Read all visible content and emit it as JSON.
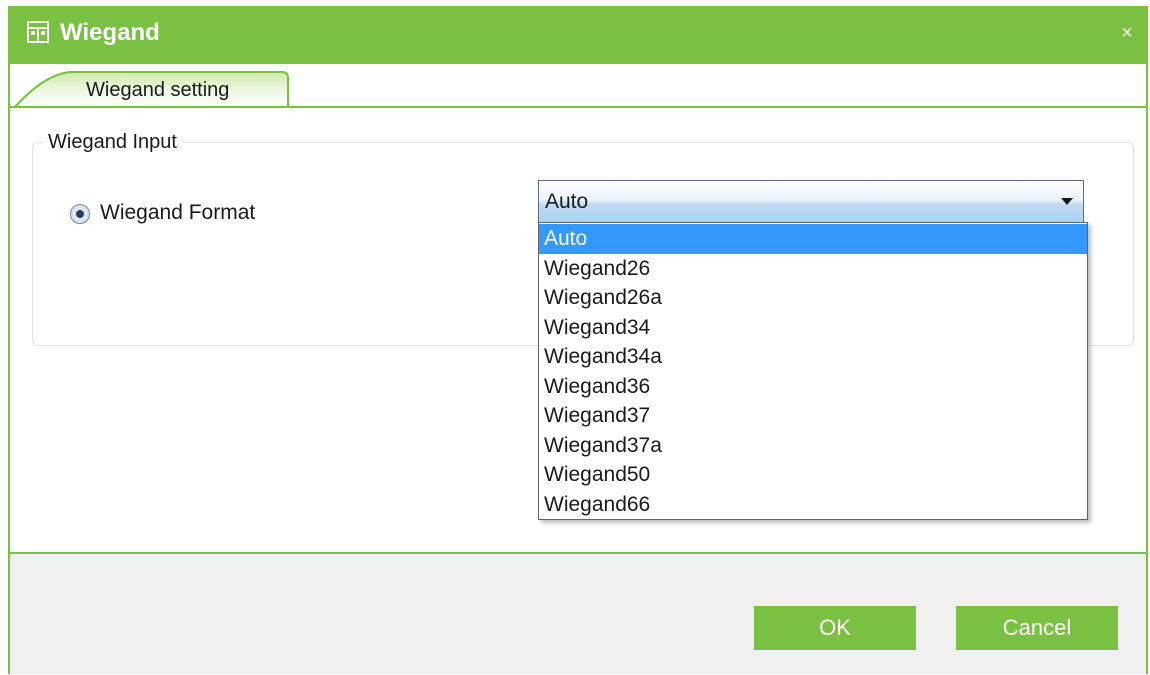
{
  "window": {
    "title": "Wiegand",
    "close_symbol": "×",
    "title_icon": "wiegand-window-icon",
    "accent_color": "#7ac143"
  },
  "tabs": [
    {
      "label": "Wiegand setting",
      "active": true
    }
  ],
  "group": {
    "legend": "Wiegand Input",
    "radio_label": "Wiegand Format",
    "radio_selected": true
  },
  "select": {
    "value": "Auto",
    "open": true,
    "options": [
      "Auto",
      "Wiegand26",
      "Wiegand26a",
      "Wiegand34",
      "Wiegand34a",
      "Wiegand36",
      "Wiegand37",
      "Wiegand37a",
      "Wiegand50",
      "Wiegand66"
    ],
    "highlight_color": "#3399ff"
  },
  "buttons": {
    "ok": "OK",
    "cancel": "Cancel"
  }
}
